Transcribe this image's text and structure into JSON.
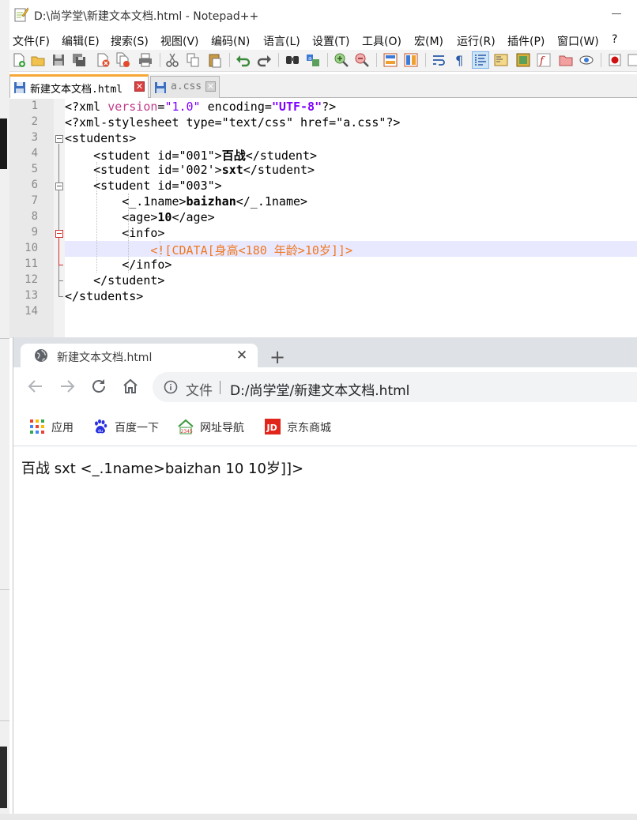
{
  "notepad": {
    "title": "D:\\尚学堂\\新建文本文档.html - Notepad++",
    "menu": [
      "文件(F)",
      "编辑(E)",
      "搜索(S)",
      "视图(V)",
      "编码(N)",
      "语言(L)",
      "设置(T)",
      "工具(O)",
      "宏(M)",
      "运行(R)",
      "插件(P)",
      "窗口(W)",
      "?"
    ],
    "tabs": [
      {
        "label": "新建文本文档.html",
        "active": true
      },
      {
        "label": "a.css",
        "active": false
      }
    ],
    "close_glyph": "✕",
    "line_numbers": [
      "1",
      "2",
      "3",
      "4",
      "5",
      "6",
      "7",
      "8",
      "9",
      "10",
      "11",
      "12",
      "13",
      "14"
    ],
    "code": {
      "l1": {
        "a": "<?xml ",
        "b": "version",
        "c": "=",
        "d": "\"1.0\"",
        "e": " encoding=",
        "f": "\"UTF-8\"",
        "g": "?>"
      },
      "l2": "<?xml-stylesheet type=\"text/css\" href=\"a.css\"?>",
      "l3": "<students>",
      "l4": {
        "a": "    <student id=\"001\">",
        "b": "百战",
        "c": "</student>"
      },
      "l5": {
        "a": "    <student id='002'>",
        "b": "sxt",
        "c": "</student>"
      },
      "l6": "    <student id=\"003\">",
      "l7": {
        "a": "        <_.1name>",
        "b": "baizhan",
        "c": "</_.1name>"
      },
      "l8": {
        "a": "        <age>",
        "b": "10",
        "c": "</age>"
      },
      "l9": "        <info>",
      "l10": "            <![CDATA[身高<180 年龄>10岁]]>",
      "l11": "        </info>",
      "l12": "    </student>",
      "l13": "</students>",
      "l14": ""
    },
    "colors": {
      "tab_accent": "#f7a733",
      "highlight_line": "#e8e8ff",
      "cdata": "#f07820",
      "attr_value": "#8000ff"
    }
  },
  "browser": {
    "tab_title": "新建文本文档.html",
    "close_glyph": "✕",
    "new_tab_glyph": "+",
    "omnibox_label": "文件",
    "url": "D:/尚学堂/新建文本文档.html",
    "bookmarks": [
      {
        "label": "应用",
        "icon": "apps-grid-icon"
      },
      {
        "label": "百度一下",
        "icon": "baidu-paw-icon"
      },
      {
        "label": "网址导航",
        "icon": "2345-house-icon"
      },
      {
        "label": "京东商城",
        "icon": "jd-icon"
      }
    ],
    "page_text": "百战 sxt <_.1name>baizhan 10 10岁]]>"
  }
}
